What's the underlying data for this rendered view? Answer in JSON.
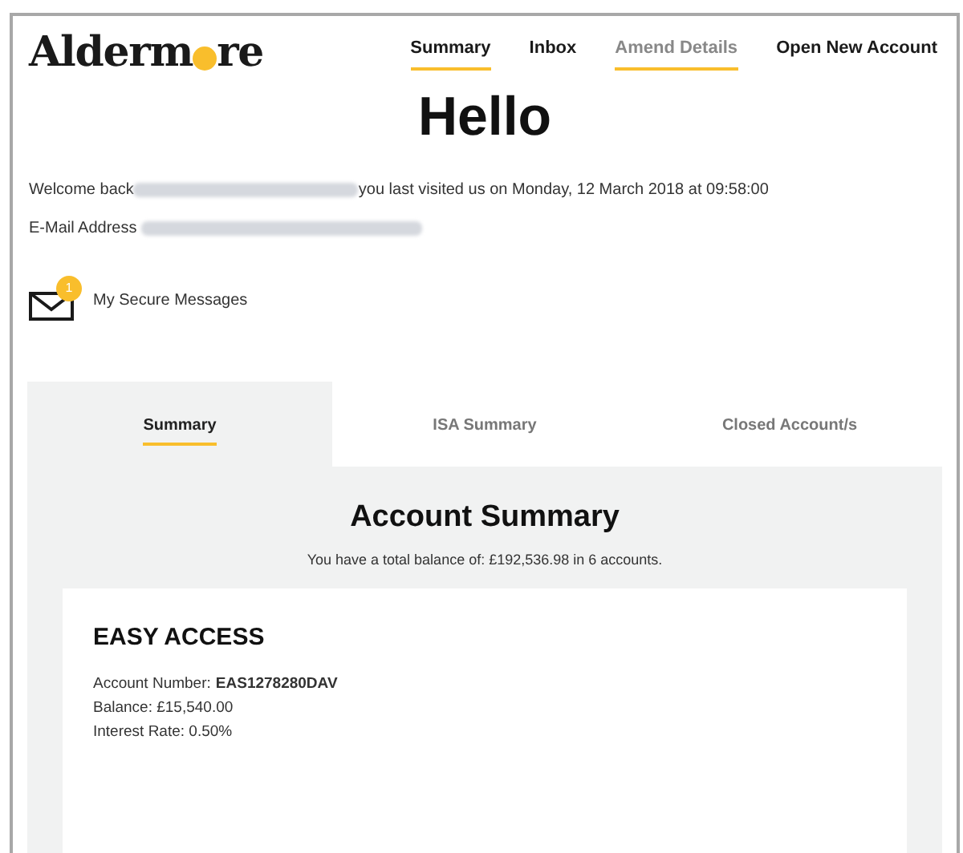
{
  "logo": {
    "text_start": "Alderm",
    "text_end": "re"
  },
  "nav": [
    {
      "label": "Summary",
      "underlined": true,
      "greyed": false
    },
    {
      "label": "Inbox",
      "underlined": false,
      "greyed": false
    },
    {
      "label": "Amend Details",
      "underlined": true,
      "greyed": true
    },
    {
      "label": "Open New Account",
      "underlined": false,
      "greyed": false
    }
  ],
  "heading": "Hello",
  "welcome": {
    "before": "Welcome back",
    "after": "you last visited us on Monday, 12 March 2018 at 09:58:00"
  },
  "email": {
    "label": "E-Mail Address"
  },
  "messages": {
    "label": "My Secure Messages",
    "badge": "1"
  },
  "tabs": [
    {
      "label": "Summary",
      "selected": true
    },
    {
      "label": "ISA Summary",
      "selected": false
    },
    {
      "label": "Closed Account/s",
      "selected": false
    }
  ],
  "summary": {
    "title": "Account Summary",
    "total": "You have a total balance of: £192,536.98 in 6 accounts."
  },
  "account": {
    "name": "EASY ACCESS",
    "number_label": "Account Number:",
    "number": "EAS1278280DAV",
    "balance": "Balance: £15,540.00",
    "rate": "Interest Rate: 0.50%"
  }
}
